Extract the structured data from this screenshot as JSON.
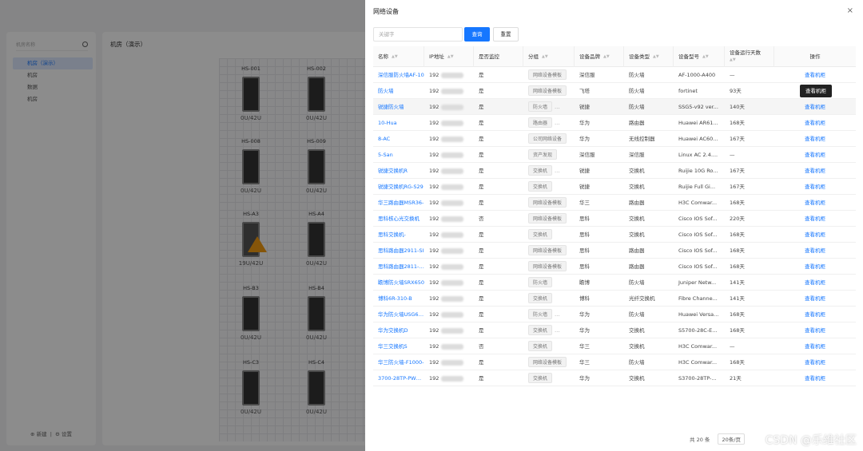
{
  "background": {
    "sidebar": {
      "search_placeholder": "机房名称",
      "tree": [
        {
          "label": "机房（演示）",
          "active": true
        },
        {
          "label": "机房",
          "active": false
        },
        {
          "label": "数据",
          "active": false
        },
        {
          "label": "机房",
          "active": false
        }
      ],
      "add_label": "新建",
      "settings_label": "设置"
    },
    "main_title": "机房（演示）",
    "racks": [
      {
        "name": "HS-001",
        "cap": "0U/42U"
      },
      {
        "name": "HS-002",
        "cap": "0U/42U"
      },
      {
        "name": "HS-008",
        "cap": "0U/42U"
      },
      {
        "name": "HS-009",
        "cap": "0U/42U"
      },
      {
        "name": "HS-A3",
        "cap": "19U/42U"
      },
      {
        "name": "HS-A4",
        "cap": "0U/42U"
      },
      {
        "name": "HS-B3",
        "cap": "0U/42U"
      },
      {
        "name": "HS-B4",
        "cap": "0U/42U"
      },
      {
        "name": "HS-C3",
        "cap": "0U/42U"
      },
      {
        "name": "HS-C4",
        "cap": "0U/42U"
      }
    ]
  },
  "drawer": {
    "title": "网络设备",
    "close": "×",
    "keyword_placeholder": "关键字",
    "query_label": "查询",
    "reset_label": "重置",
    "columns": [
      "名称",
      "IP地址",
      "是否监控",
      "分组",
      "设备品牌",
      "设备类型",
      "设备型号",
      "设备运行天数",
      "操作"
    ],
    "sort_glyph": "▲▼",
    "ip_prefix": "192",
    "action_label": "查看机柜",
    "tooltip": "查看机柜",
    "rows": [
      {
        "name": "深信服防火墙AF-10",
        "mon": "是",
        "group": "网络设备模板",
        "more": "",
        "brand": "深信服",
        "type": "防火墙",
        "model": "AF-1000-A400",
        "days": "—"
      },
      {
        "name": "防火墙",
        "mon": "是",
        "group": "网络设备模板",
        "more": "",
        "brand": "飞塔",
        "type": "防火墙",
        "model": "fortinet",
        "days": "93天"
      },
      {
        "name": "锐捷防火墙",
        "mon": "是",
        "group": "防火墙",
        "more": "…",
        "brand": "锐捷",
        "type": "防火墙",
        "model": "SSG5-v92 ver...",
        "days": "140天"
      },
      {
        "name": "10-Hua",
        "mon": "是",
        "group": "路由器",
        "more": "…",
        "brand": "华为",
        "type": "路由器",
        "model": "Huawei AR61...",
        "days": "168天"
      },
      {
        "name": "8-AC",
        "mon": "是",
        "group": "公司网络设备",
        "more": "",
        "brand": "华为",
        "type": "无线控制器",
        "model": "Huawei AC60...",
        "days": "167天"
      },
      {
        "name": "5-San",
        "mon": "是",
        "group": "资产发现",
        "more": "",
        "brand": "深信服",
        "type": "深信服",
        "model": "Linux AC 2.4....",
        "days": "—"
      },
      {
        "name": "锐捷交换机R",
        "mon": "是",
        "group": "交换机",
        "more": "…",
        "brand": "锐捷",
        "type": "交换机",
        "model": "Ruijie 10G Ro...",
        "days": "167天"
      },
      {
        "name": "锐捷交换机RG-S29",
        "mon": "是",
        "group": "交换机",
        "more": "",
        "brand": "锐捷",
        "type": "交换机",
        "model": "Ruijie Full Gi...",
        "days": "167天"
      },
      {
        "name": "华三路由器MSR36-",
        "mon": "是",
        "group": "网络设备模板",
        "more": "",
        "brand": "华三",
        "type": "路由器",
        "model": "H3C Comwar...",
        "days": "168天"
      },
      {
        "name": "思科核心光交换机",
        "mon": "否",
        "group": "网络设备模板",
        "more": "",
        "brand": "思科",
        "type": "交换机",
        "model": "Cisco IOS Sof...",
        "days": "220天"
      },
      {
        "name": "思科交换机-",
        "mon": "是",
        "group": "交换机",
        "more": "",
        "brand": "思科",
        "type": "交换机",
        "model": "Cisco IOS Sof...",
        "days": "168天"
      },
      {
        "name": "思科路由器2911-SI",
        "mon": "是",
        "group": "网络设备模板",
        "more": "",
        "brand": "思科",
        "type": "路由器",
        "model": "Cisco IOS Sof...",
        "days": "168天"
      },
      {
        "name": "思科路由器2811-K9",
        "mon": "是",
        "group": "网络设备模板",
        "more": "",
        "brand": "思科",
        "type": "路由器",
        "model": "Cisco IOS Sof...",
        "days": "168天"
      },
      {
        "name": "瞻博防火墙SRX650",
        "mon": "是",
        "group": "防火墙",
        "more": "",
        "brand": "瞻博",
        "type": "防火墙",
        "model": "Juniper Netw...",
        "days": "141天"
      },
      {
        "name": "博科6R-310-B",
        "mon": "是",
        "group": "交换机",
        "more": "",
        "brand": "博科",
        "type": "光纤交换机",
        "model": "Fibre Channe...",
        "days": "141天"
      },
      {
        "name": "华为防火墙USG630",
        "mon": "是",
        "group": "防火墙",
        "more": "…",
        "brand": "华为",
        "type": "防火墙",
        "model": "Huawei Versa...",
        "days": "168天"
      },
      {
        "name": "华为交换机D",
        "mon": "是",
        "group": "交换机",
        "more": "…",
        "brand": "华为",
        "type": "交换机",
        "model": "S5700-28C-E...",
        "days": "168天"
      },
      {
        "name": "华三交换机S",
        "mon": "否",
        "group": "交换机",
        "more": "",
        "brand": "华三",
        "type": "交换机",
        "model": "H3C Comwar...",
        "days": "—"
      },
      {
        "name": "华三防火墙-F1000-",
        "mon": "是",
        "group": "网络设备模板",
        "more": "",
        "brand": "华三",
        "type": "防火墙",
        "model": "H3C Comwar...",
        "days": "168天"
      },
      {
        "name": "3700-28TP-PWR-E",
        "mon": "是",
        "group": "交换机",
        "more": "",
        "brand": "华为",
        "type": "交换机",
        "model": "S3700-28TP-...",
        "days": "21天"
      }
    ],
    "pager": {
      "total": "共 20 条",
      "size": "20条/页"
    },
    "watermark": "CSDN @乐维社区"
  }
}
